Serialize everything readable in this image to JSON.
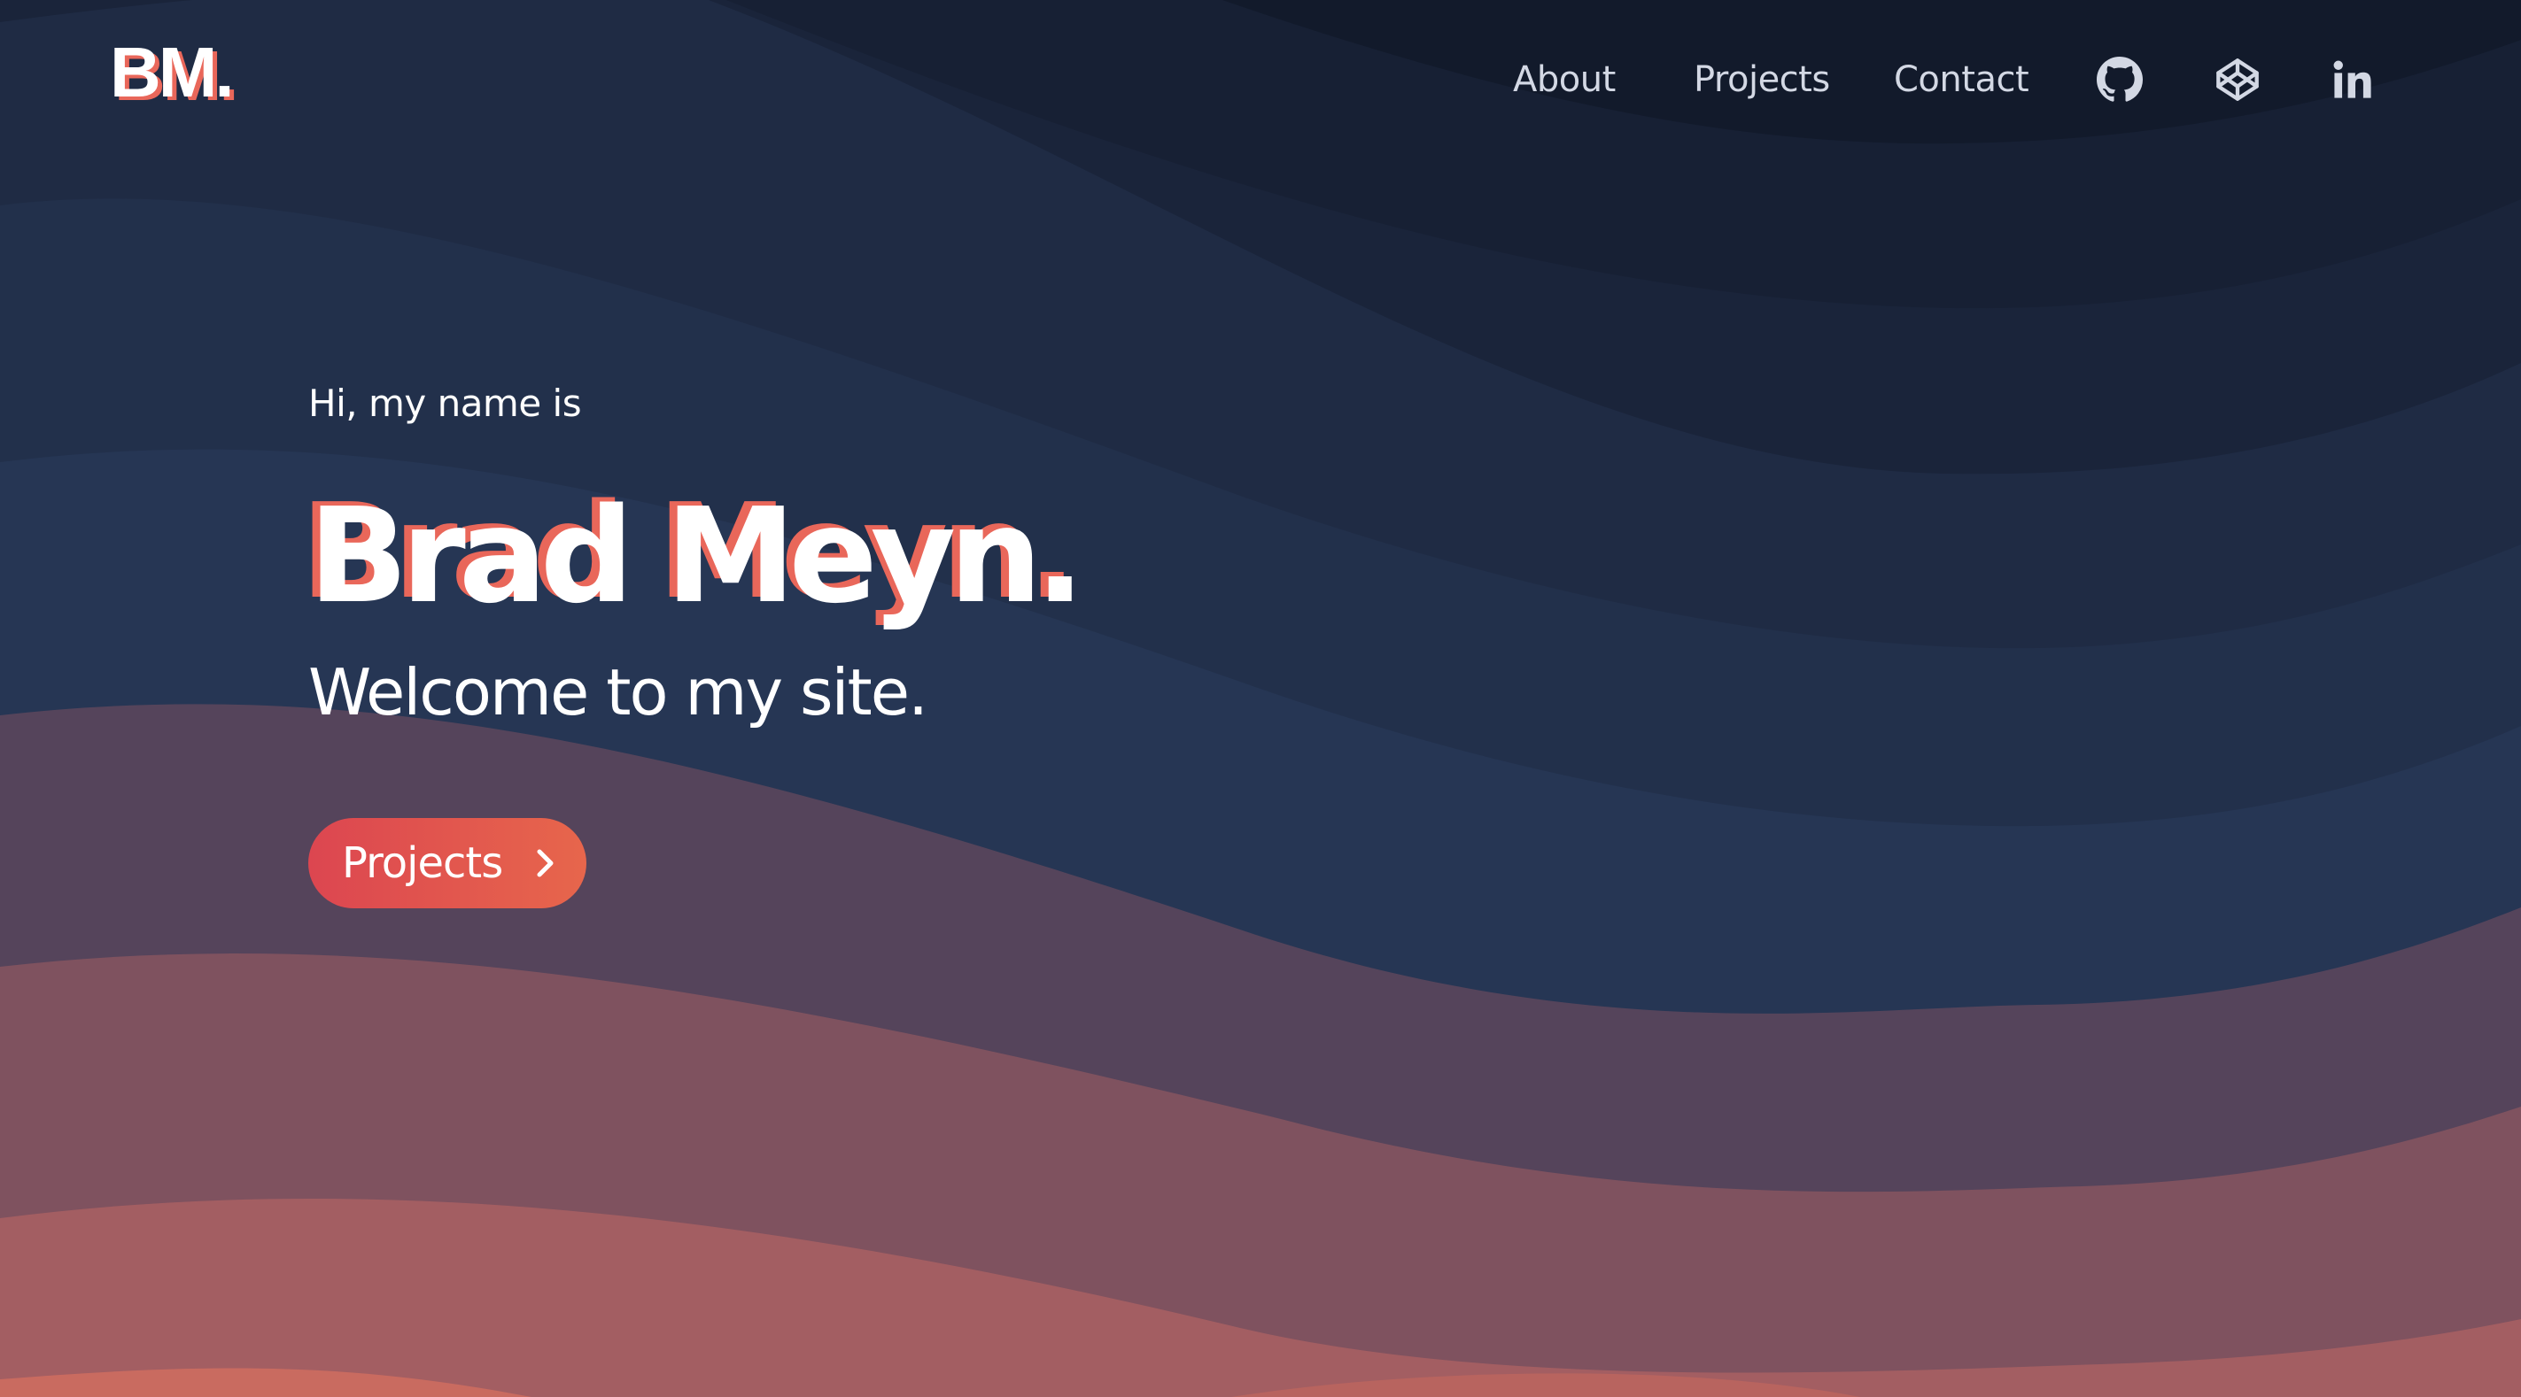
{
  "header": {
    "logo": "BM.",
    "nav": {
      "about": "About",
      "projects": "Projects",
      "contact": "Contact"
    },
    "social_icons": [
      "github-icon",
      "codepen-icon",
      "linkedin-icon"
    ]
  },
  "hero": {
    "intro": "Hi, my name is",
    "name": "Brad Meyn.",
    "tagline": "Welcome to my site.",
    "cta_label": "Projects"
  },
  "colors": {
    "accent": "#e9675a",
    "button_start": "#dc4650",
    "button_end": "#e7664c",
    "background_dark": "#121a2b",
    "background_navy": "#263654",
    "background_coral": "#c96b60",
    "nav_text": "#d3d8e4"
  }
}
